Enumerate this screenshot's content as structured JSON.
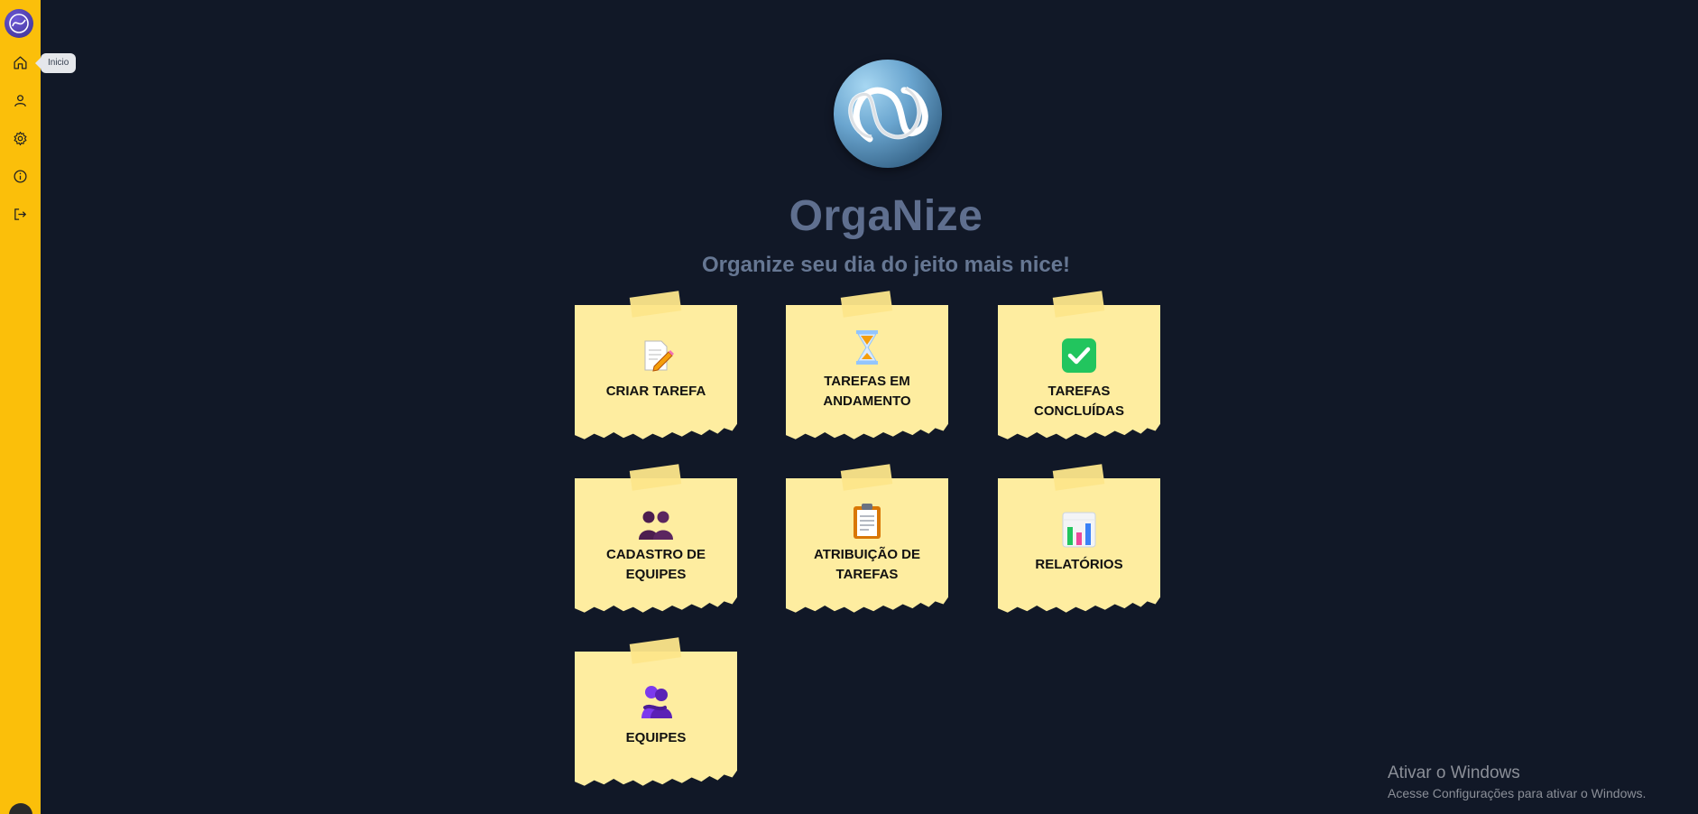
{
  "sidebar": {
    "logo": "organize-logo",
    "items": [
      {
        "name": "home",
        "icon": "home-icon"
      },
      {
        "name": "profile",
        "icon": "user-icon"
      },
      {
        "name": "settings",
        "icon": "gear-icon"
      },
      {
        "name": "info",
        "icon": "info-icon"
      },
      {
        "name": "logout",
        "icon": "logout-icon"
      }
    ],
    "tooltip": "Inicio"
  },
  "hero": {
    "title": "OrgaNize",
    "subtitle": "Organize seu dia do jeito mais nice!"
  },
  "cards": [
    {
      "label": "CRIAR TAREFA",
      "icon": "memo-pencil-icon"
    },
    {
      "label": "TAREFAS EM ANDAMENTO",
      "icon": "hourglass-icon"
    },
    {
      "label": "TAREFAS CONCLUÍDAS",
      "icon": "check-mark-icon"
    },
    {
      "label": "CADASTRO DE EQUIPES",
      "icon": "people-icon"
    },
    {
      "label": "ATRIBUIÇÃO DE TAREFAS",
      "icon": "clipboard-icon"
    },
    {
      "label": "RELATÓRIOS",
      "icon": "bar-chart-icon"
    },
    {
      "label": "EQUIPES",
      "icon": "people-hugging-icon"
    }
  ],
  "windows_watermark": {
    "title": "Ativar o Windows",
    "subtitle": "Acesse Configurações para ativar o Windows."
  },
  "colors": {
    "background": "#111827",
    "sidebar": "#fbbf0a",
    "note": "#feeda0",
    "title": "#5f6f8f"
  }
}
